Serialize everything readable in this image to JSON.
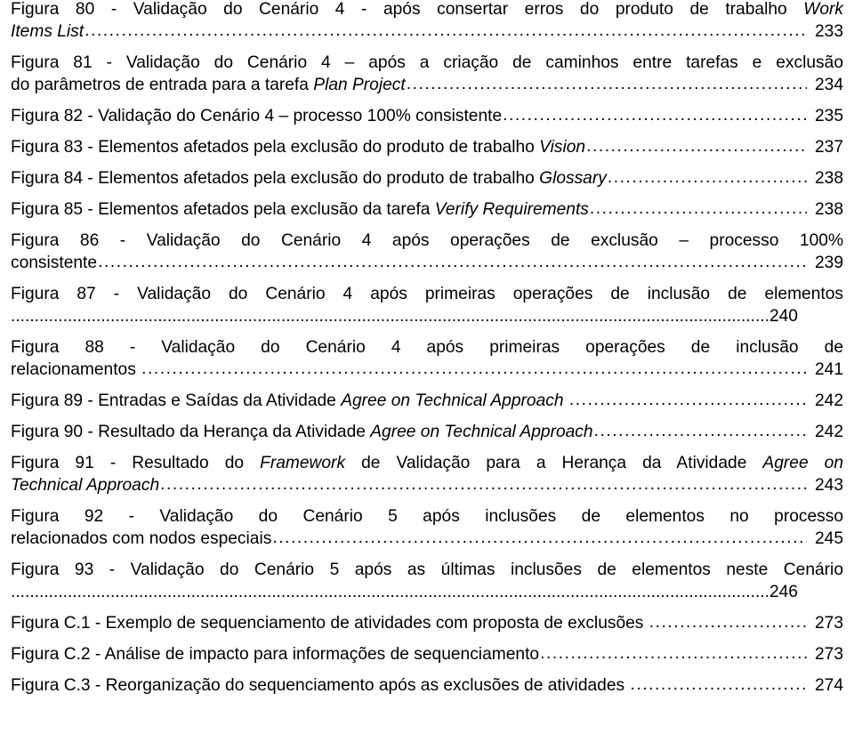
{
  "document": {
    "section_kind": "lista-de-figuras",
    "leader_char": "."
  },
  "entries": [
    {
      "id": "figura-80",
      "line1": "Figura 80 - Validação do Cenário 4 - após consertar erros do produto de trabalho ",
      "line1_italic": "Work",
      "tail_text": "Items List",
      "tail_italic": true,
      "page": "233",
      "layout": "justified-first-line"
    },
    {
      "id": "figura-81",
      "line1": "Figura 81 - Validação do Cenário 4 – após a criação de caminhos entre tarefas e exclusão",
      "line1_italic": "",
      "tail_text": "do parâmetros de entrada para a tarefa ",
      "tail_italic_text": "Plan Project",
      "page": "234",
      "layout": "justified-first-line"
    },
    {
      "id": "figura-82",
      "tail_text": "Figura 82 - Validação do Cenário 4 – processo 100% consistente",
      "page": "235",
      "layout": "single-line"
    },
    {
      "id": "figura-83",
      "tail_text": "Figura 83 - Elementos afetados pela exclusão do produto de trabalho ",
      "tail_italic_text": "Vision",
      "page": "237",
      "layout": "single-line"
    },
    {
      "id": "figura-84",
      "tail_text": "Figura 84 - Elementos afetados pela exclusão do produto de trabalho ",
      "tail_italic_text": "Glossary",
      "page": "238",
      "layout": "single-line"
    },
    {
      "id": "figura-85",
      "tail_text": "Figura 85 - Elementos afetados pela exclusão da tarefa ",
      "tail_italic_text": "Verify Requirements",
      "page": "238",
      "layout": "single-line"
    },
    {
      "id": "figura-86",
      "line1": "Figura 86 - Validação do Cenário 4 após operações de exclusão – processo 100%",
      "tail_text": "consistente",
      "page": "239",
      "layout": "justified-first-line"
    },
    {
      "id": "figura-87",
      "line1": "Figura 87 - Validação do Cenário 4 após primeiras operações de inclusão de elementos",
      "tail_text": "",
      "page": "240",
      "layout": "leaders-own-line"
    },
    {
      "id": "figura-88",
      "line1": "Figura 88 - Validação do Cenário 4 após primeiras operações de inclusão de",
      "tail_text": "relacionamentos ",
      "page": "241",
      "layout": "justified-first-line"
    },
    {
      "id": "figura-89",
      "tail_text": "Figura 89 - Entradas e Saídas da Atividade ",
      "tail_italic_text": "Agree on Technical Approach ",
      "page": "242",
      "layout": "single-line"
    },
    {
      "id": "figura-90",
      "tail_text": "Figura 90 - Resultado da Herança da Atividade ",
      "tail_italic_text": "Agree on Technical Approach",
      "page": "242",
      "layout": "single-line"
    },
    {
      "id": "figura-91",
      "line1_pre": "Figura 91 - Resultado do ",
      "line1_italic": "Framework",
      "line1_post": " de Validação para a Herança da Atividade ",
      "line1_italic2": "Agree on",
      "tail_italic_text": "Technical Approach",
      "page": "243",
      "layout": "justified-first-line-rich"
    },
    {
      "id": "figura-92",
      "line1": "Figura 92 - Validação do Cenário 5 após inclusões de elementos no processo",
      "tail_text": "relacionados com nodos especiais",
      "page": "245",
      "layout": "justified-first-line"
    },
    {
      "id": "figura-93",
      "line1": "Figura 93 - Validação do Cenário 5 após as últimas inclusões de elementos neste Cenário",
      "tail_text": "",
      "page": "246",
      "layout": "leaders-own-line"
    },
    {
      "id": "figura-c1",
      "tail_text": "Figura C.1 - Exemplo de sequenciamento de atividades com proposta de exclusões ",
      "page": "273",
      "layout": "single-line"
    },
    {
      "id": "figura-c2",
      "tail_text": "Figura C.2 - Análise de impacto para informações de sequenciamento",
      "page": "273",
      "layout": "single-line"
    },
    {
      "id": "figura-c3",
      "tail_text": "Figura C.3 - Reorganização do sequenciamento após as exclusões de atividades ",
      "page": "274",
      "layout": "single-line"
    }
  ]
}
